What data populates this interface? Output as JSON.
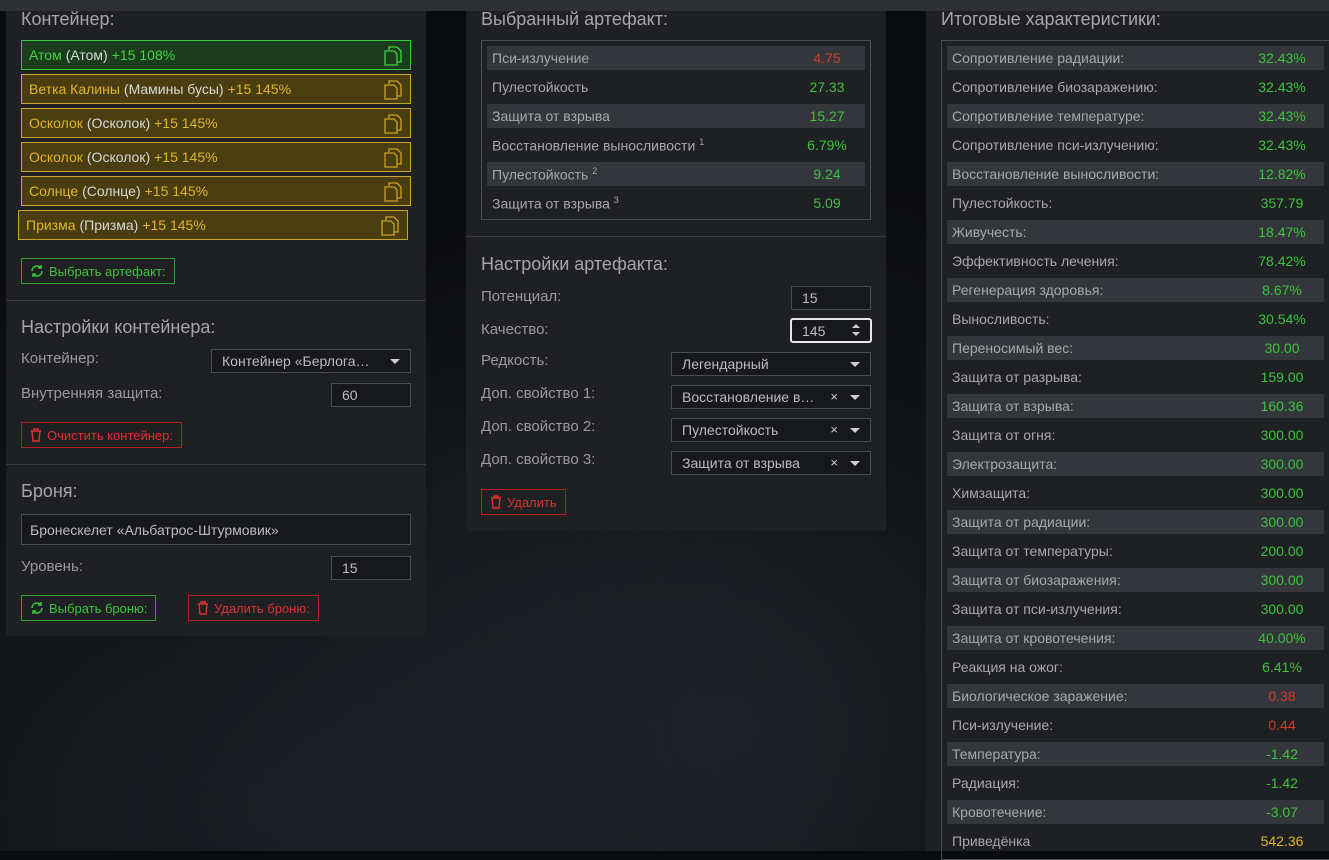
{
  "container": {
    "title": "Контейнер:",
    "artifacts": [
      {
        "name": "Атом",
        "alt": "(Атом)",
        "level": "+15 108%",
        "state": "green"
      },
      {
        "name": "Ветка Калины",
        "alt": "(Мамины бусы)",
        "level": "+15 145%",
        "state": "gold"
      },
      {
        "name": "Осколок",
        "alt": "(Осколок)",
        "level": "+15 145%",
        "state": "gold"
      },
      {
        "name": "Осколок",
        "alt": "(Осколок)",
        "level": "+15 145%",
        "state": "gold"
      },
      {
        "name": "Солнце",
        "alt": "(Солнце)",
        "level": "+15 145%",
        "state": "gold"
      },
      {
        "name": "Призма",
        "alt": "(Призма)",
        "level": "+15 145%",
        "state": "gold"
      }
    ],
    "select_artifact_label": "Выбрать артефакт:",
    "settings_title": "Настройки контейнера:",
    "container_label": "Контейнер:",
    "container_value": "Контейнер «Берлога…",
    "inner_protection_label": "Внутренняя защита:",
    "inner_protection_value": "60",
    "clear_label": "Очистить контейнер:"
  },
  "armor": {
    "title": "Броня:",
    "armor_value": "Бронескелет «Альбатрос-Штурмовик»",
    "level_label": "Уровень:",
    "level_value": "15",
    "select_label": "Выбрать броню:",
    "delete_label": "Удалить броню:"
  },
  "selected": {
    "title": "Выбранный артефакт:",
    "stats": [
      {
        "name": "Пси-излучение",
        "sup": "",
        "value": "4.75",
        "color": "#d23a2a"
      },
      {
        "name": "Пулестойкость",
        "sup": "",
        "value": "27.33",
        "color": "#3cc43c"
      },
      {
        "name": "Защита от взрыва",
        "sup": "",
        "value": "15.27",
        "color": "#3cc43c"
      },
      {
        "name": "Восстановление выносливости",
        "sup": "1",
        "value": "6.79%",
        "color": "#3cc43c"
      },
      {
        "name": "Пулестойкость",
        "sup": "2",
        "value": "9.24",
        "color": "#3cc43c"
      },
      {
        "name": "Защита от взрыва",
        "sup": "3",
        "value": "5.09",
        "color": "#3cc43c"
      }
    ]
  },
  "art_settings": {
    "title": "Настройки артефакта:",
    "potential_label": "Потенциал:",
    "potential_value": "15",
    "quality_label": "Качество:",
    "quality_value": "145",
    "rarity_label": "Редкость:",
    "rarity_value": "Легендарный",
    "extra1_label": "Доп. свойство 1:",
    "extra1_value": "Восстановление в…",
    "extra2_label": "Доп. свойство 2:",
    "extra2_value": "Пулестойкость",
    "extra3_label": "Доп. свойство 3:",
    "extra3_value": "Защита от взрыва",
    "delete_label": "Удалить"
  },
  "totals": {
    "title": "Итоговые характеристики:",
    "stats": [
      {
        "name": "Сопротивление радиации:",
        "value": "32.43%",
        "color": "#3cc43c"
      },
      {
        "name": "Сопротивление биозаражению:",
        "value": "32.43%",
        "color": "#3cc43c"
      },
      {
        "name": "Сопротивление температуре:",
        "value": "32.43%",
        "color": "#3cc43c"
      },
      {
        "name": "Сопротивление пси-излучению:",
        "value": "32.43%",
        "color": "#3cc43c"
      },
      {
        "name": "Восстановление выносливости:",
        "value": "12.82%",
        "color": "#3cc43c"
      },
      {
        "name": "Пулестойкость:",
        "value": "357.79",
        "color": "#3cc43c"
      },
      {
        "name": "Живучесть:",
        "value": "18.47%",
        "color": "#3cc43c"
      },
      {
        "name": "Эффективность лечения:",
        "value": "78.42%",
        "color": "#3cc43c"
      },
      {
        "name": "Регенерация здоровья:",
        "value": "8.67%",
        "color": "#3cc43c"
      },
      {
        "name": "Выносливость:",
        "value": "30.54%",
        "color": "#3cc43c"
      },
      {
        "name": "Переносимый вес:",
        "value": "30.00",
        "color": "#3cc43c"
      },
      {
        "name": "Защита от разрыва:",
        "value": "159.00",
        "color": "#3cc43c"
      },
      {
        "name": "Защита от взрыва:",
        "value": "160.36",
        "color": "#3cc43c"
      },
      {
        "name": "Защита от огня:",
        "value": "300.00",
        "color": "#3cc43c"
      },
      {
        "name": "Электрозащита:",
        "value": "300.00",
        "color": "#3cc43c"
      },
      {
        "name": "Химзащита:",
        "value": "300.00",
        "color": "#3cc43c"
      },
      {
        "name": "Защита от радиации:",
        "value": "300.00",
        "color": "#3cc43c"
      },
      {
        "name": "Защита от температуры:",
        "value": "200.00",
        "color": "#3cc43c"
      },
      {
        "name": "Защита от биозаражения:",
        "value": "300.00",
        "color": "#3cc43c"
      },
      {
        "name": "Защита от пси-излучения:",
        "value": "300.00",
        "color": "#3cc43c"
      },
      {
        "name": "Защита от кровотечения:",
        "value": "40.00%",
        "color": "#3cc43c"
      },
      {
        "name": "Реакция на ожог:",
        "value": "6.41%",
        "color": "#3cc43c"
      },
      {
        "name": "Биологическое заражение:",
        "value": "0.38",
        "color": "#d23a2a"
      },
      {
        "name": "Пси-излучение:",
        "value": "0.44",
        "color": "#d23a2a"
      },
      {
        "name": "Температура:",
        "value": "-1.42",
        "color": "#3cc43c"
      },
      {
        "name": "Радиация:",
        "value": "-1.42",
        "color": "#3cc43c"
      },
      {
        "name": "Кровотечение:",
        "value": "-3.07",
        "color": "#3cc43c"
      },
      {
        "name": "Приведёнка",
        "value": "542.36",
        "color": "#e0b52a"
      }
    ]
  },
  "colors": {
    "green": "#3cc43c",
    "red": "#d23a2a",
    "gold": "#e0b52a"
  }
}
